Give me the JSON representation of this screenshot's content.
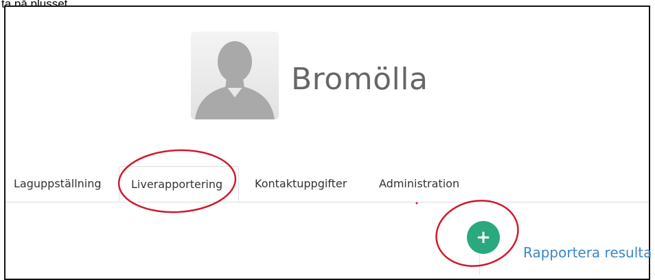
{
  "caption": "ta på plusset.",
  "team": {
    "name": "Bromölla"
  },
  "tabs": [
    {
      "label": "Laguppställning"
    },
    {
      "label": "Liverapportering",
      "active": true
    },
    {
      "label": "Kontaktuppgifter"
    },
    {
      "label": "Administration"
    }
  ],
  "actions": {
    "add_icon": "plus-icon",
    "report_label": "Rapportera resulta"
  },
  "colors": {
    "accent_green": "#2aa87e",
    "link_blue": "#3a87c8",
    "annotation_red": "#d0192b"
  }
}
